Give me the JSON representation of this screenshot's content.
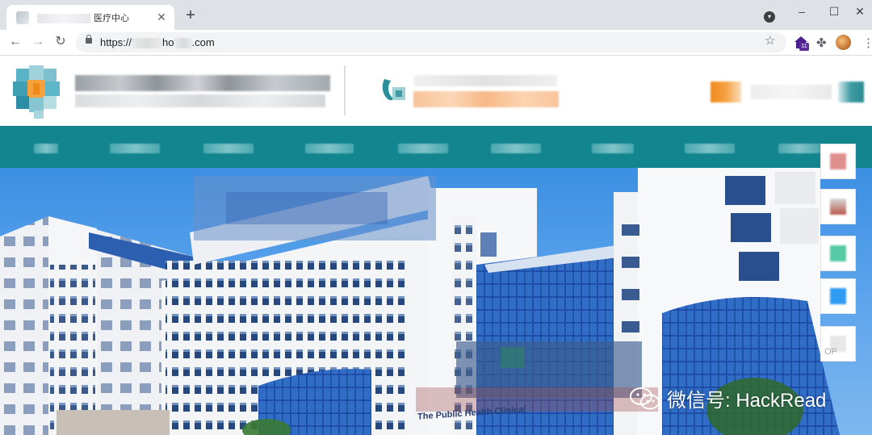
{
  "browser": {
    "tab": {
      "title": "医疗中心",
      "close_icon": "close-icon"
    },
    "new_tab_label": "+",
    "url_prefix": "https://",
    "url_mid": "ho",
    "url_suffix": ".com",
    "extension_badge": "11",
    "window_controls": {
      "minimize": "–",
      "maximize": "☐",
      "close": "✕"
    }
  },
  "header": {
    "accent_color": "#12858f"
  },
  "hero": {
    "sign_text": "The Public Health Clinical",
    "float_top_label": "OP"
  },
  "watermark": {
    "text": "微信号: HackRead"
  }
}
